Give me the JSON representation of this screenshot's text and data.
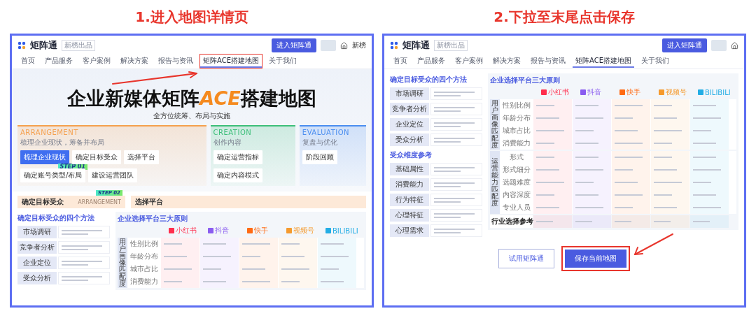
{
  "panels": [
    {
      "caption": "1.进入地图详情页",
      "kind": "hero",
      "header": {
        "logo": "矩阵通",
        "badge": "新榜出品",
        "nav": [
          {
            "label": "首页",
            "selected": false,
            "highlighted": false
          },
          {
            "label": "产品服务",
            "selected": false,
            "highlighted": false
          },
          {
            "label": "客户案例",
            "selected": false,
            "highlighted": false
          },
          {
            "label": "解决方案",
            "selected": false,
            "highlighted": false
          },
          {
            "label": "报告与资讯",
            "selected": false,
            "highlighted": false
          },
          {
            "label": "矩阵ACE搭建地图",
            "selected": true,
            "highlighted": true
          },
          {
            "label": "关于我们",
            "selected": false,
            "highlighted": false
          }
        ],
        "enter_button": "进入矩阵通",
        "user": "新榜"
      },
      "hero": {
        "title_parts": [
          {
            "text": "企业新媒体矩阵",
            "accent": false
          },
          {
            "text": "ACE",
            "accent": true
          },
          {
            "text": "搭建地图",
            "accent": false
          }
        ],
        "subtitle": "全方位统筹、布局与实施",
        "phases": [
          {
            "name": "ARRANGEMENT",
            "note": "梳理企业现状，筹备并布局",
            "color": "#f5a04e",
            "steps": [
              {
                "label": "梳理企业现状",
                "selected": true
              },
              {
                "label": "确定目标受众",
                "selected": false
              },
              {
                "label": "选择平台",
                "selected": false
              },
              {
                "label": "确定账号类型/布局",
                "selected": false
              },
              {
                "label": "建设运营团队",
                "selected": false
              }
            ]
          },
          {
            "name": "CREATION",
            "note": "创作内容",
            "color": "#3dbf7a",
            "steps": [
              {
                "label": "确定运营指标",
                "selected": false
              },
              {
                "label": "确定内容模式",
                "selected": false
              }
            ]
          },
          {
            "name": "EVALUATION",
            "note": "复盘与优化",
            "color": "#4b8ef0",
            "steps": [
              {
                "label": "阶段回顾",
                "selected": false
              }
            ]
          }
        ],
        "step_badge": "STEP 01"
      },
      "sections": [
        {
          "title": "确定目标受众",
          "ghost": "ARRANGEMENT",
          "badge": "STEP 02"
        },
        {
          "title": "选择平台"
        }
      ],
      "lists": [
        {
          "title": "确定目标受众的四个方法",
          "items": [
            "市场调研",
            "竞争者分析",
            "企业定位",
            "受众分析"
          ]
        }
      ],
      "table": {
        "title": "企业选择平台三大原则",
        "platforms": [
          {
            "name": "小红书",
            "color": "#ff2e4d"
          },
          {
            "name": "抖音",
            "color": "#8a5cf0"
          },
          {
            "name": "快手",
            "color": "#ff6a13"
          },
          {
            "name": "视频号",
            "color": "#f59a2e"
          },
          {
            "name": "BILIBILI",
            "color": "#23ade5"
          }
        ],
        "groups": [
          {
            "label": "用户画像匹配度",
            "rows": [
              "性别比例",
              "年龄分布",
              "城市占比",
              "消费能力"
            ]
          }
        ]
      }
    },
    {
      "caption": "2.下拉至末尾点击保存",
      "kind": "end",
      "header": {
        "logo": "矩阵通",
        "badge": "新榜出品",
        "nav": [
          {
            "label": "首页",
            "selected": false,
            "highlighted": false
          },
          {
            "label": "产品服务",
            "selected": false,
            "highlighted": false
          },
          {
            "label": "客户案例",
            "selected": false,
            "highlighted": false
          },
          {
            "label": "解决方案",
            "selected": false,
            "highlighted": false
          },
          {
            "label": "报告与资讯",
            "selected": false,
            "highlighted": false
          },
          {
            "label": "矩阵ACE搭建地图",
            "selected": true,
            "highlighted": false
          },
          {
            "label": "关于我们",
            "selected": false,
            "highlighted": false
          }
        ],
        "enter_button": "进入矩阵通"
      },
      "lists": [
        {
          "title": "确定目标受众的四个方法",
          "items": [
            "市场调研",
            "竞争者分析",
            "企业定位",
            "受众分析"
          ]
        },
        {
          "title": "受众维度参考",
          "items": [
            "基础属性",
            "消费能力",
            "行为特征",
            "心理特征",
            "心理需求"
          ]
        }
      ],
      "table": {
        "title": "企业选择平台三大原则",
        "platforms": [
          {
            "name": "小红书",
            "color": "#ff2e4d"
          },
          {
            "name": "抖音",
            "color": "#8a5cf0"
          },
          {
            "name": "快手",
            "color": "#ff6a13"
          },
          {
            "name": "视频号",
            "color": "#f59a2e"
          },
          {
            "name": "BILIBILI",
            "color": "#23ade5"
          }
        ],
        "groups": [
          {
            "label": "用户画像匹配度",
            "rows": [
              "性别比例",
              "年龄分布",
              "城市占比",
              "消费能力"
            ]
          },
          {
            "label": "运营能力匹配度",
            "rows": [
              "形式",
              "形式细分",
              "选题难度",
              "内容深度",
              "专业人员"
            ]
          }
        ],
        "footer_row": "行业选择参考"
      },
      "buttons": [
        {
          "label": "试用矩阵通",
          "kind": "outline",
          "highlighted": false
        },
        {
          "label": "保存当前地图",
          "kind": "primary",
          "highlighted": true
        }
      ]
    }
  ]
}
